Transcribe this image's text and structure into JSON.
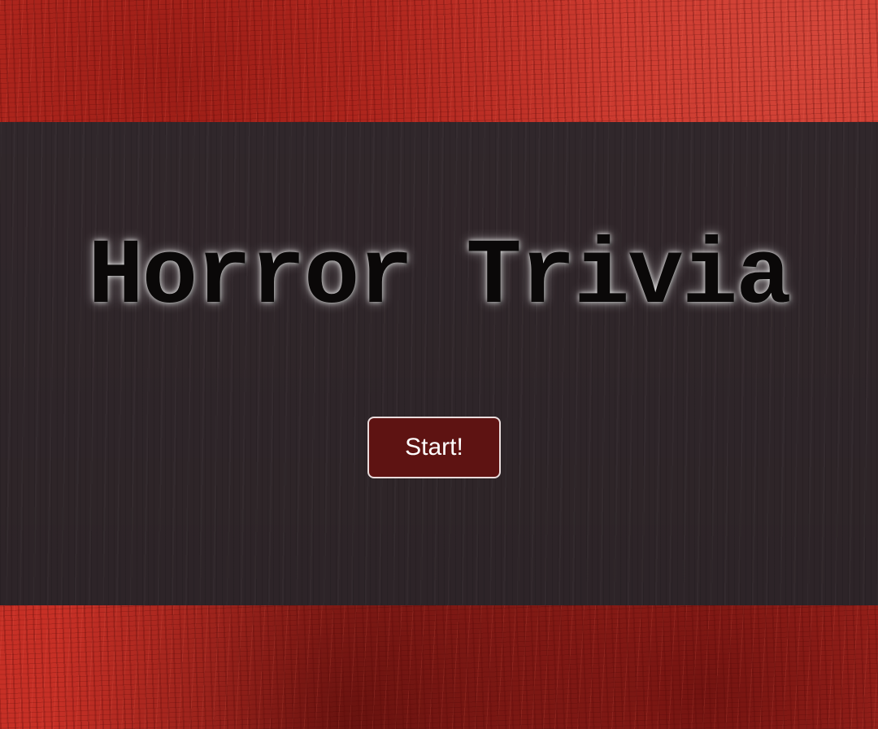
{
  "title": "Horror Trivia",
  "start_button": {
    "label": "Start!"
  },
  "colors": {
    "background_red": "#c63026",
    "band": "#33292d",
    "button_fill": "#5e1312",
    "button_border": "#e9dcdc",
    "title_text": "#0a0808",
    "title_glow": "#ffffff"
  }
}
